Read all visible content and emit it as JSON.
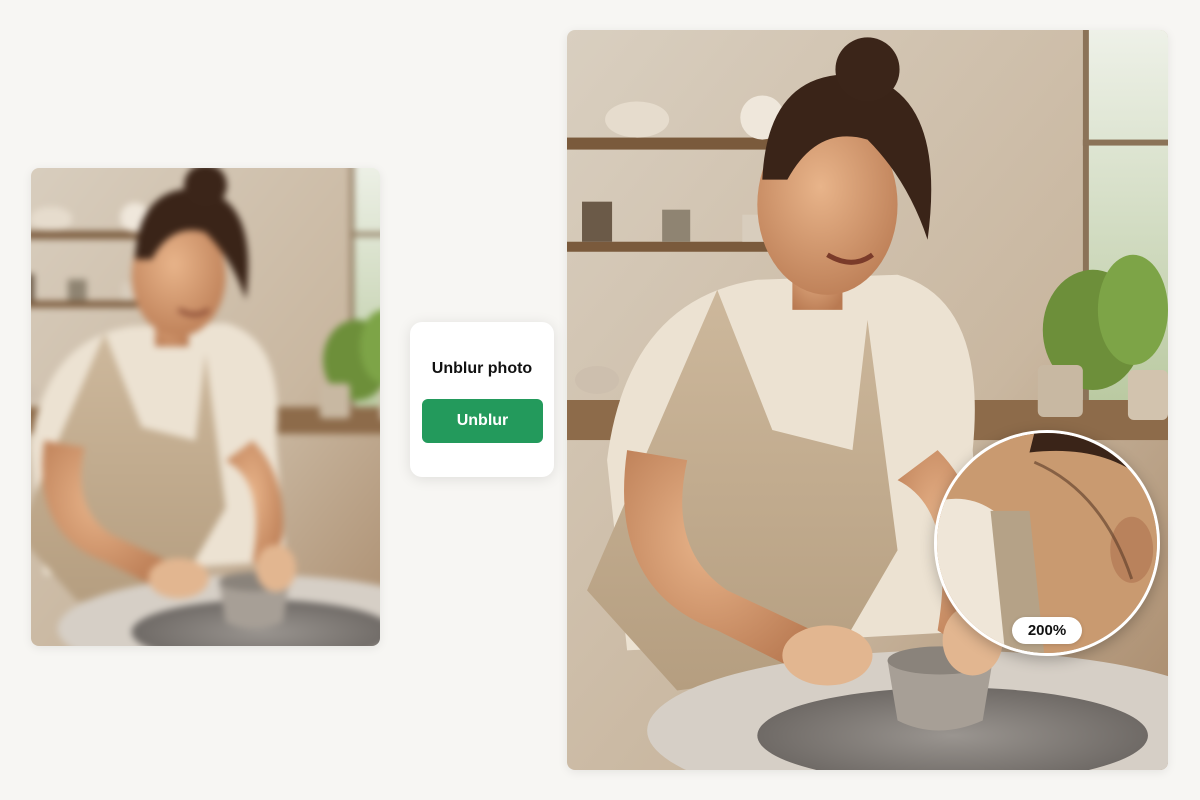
{
  "card": {
    "title": "Unblur photo",
    "button_label": "Unblur"
  },
  "zoom": {
    "label": "200%"
  },
  "colors": {
    "background": "#f7f6f3",
    "accent_button": "#239a5c",
    "card_bg": "#ffffff"
  },
  "images": {
    "before": "blurred-portrait-image",
    "after": "sharpened-portrait-image",
    "detail": "zoomed-detail-image"
  }
}
